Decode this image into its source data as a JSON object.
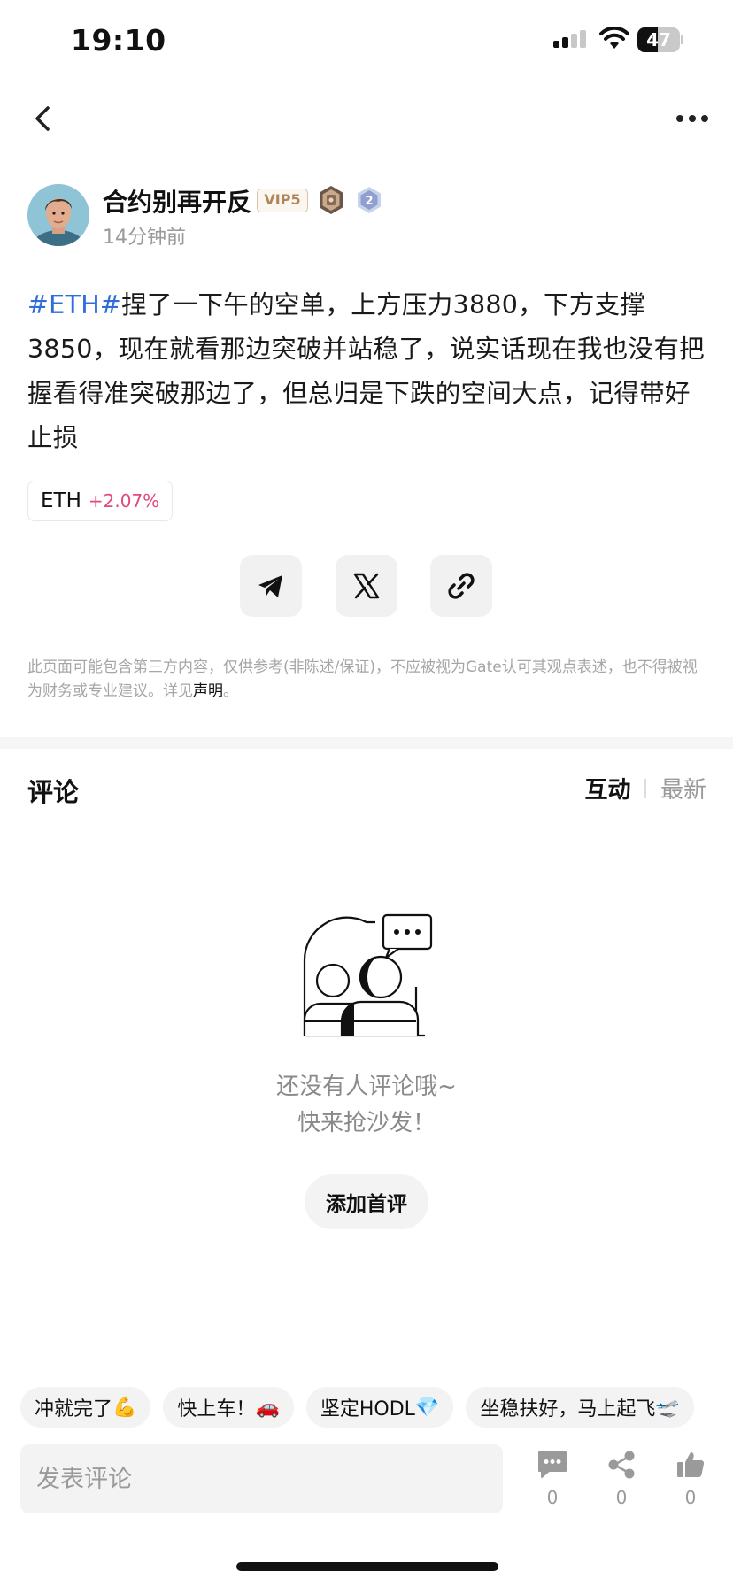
{
  "status_bar": {
    "time": "19:10",
    "battery_level": "47",
    "battery_fraction": 0.47
  },
  "nav": {
    "back_icon": "chevron-left-icon",
    "more_icon": "more-horizontal-icon"
  },
  "author": {
    "name": "合约别再开反",
    "vip_label": "VIP5",
    "level_badge": "2",
    "post_time": "14分钟前"
  },
  "post": {
    "hashtag": "#ETH#",
    "text": "捏了一下午的空单，上方压力3880，下方支撑3850，现在就看那边突破并站稳了，说实话现在我也没有把握看得准突破那边了，但总归是下跌的空间大点，记得带好止损"
  },
  "token": {
    "symbol": "ETH",
    "change": "+2.07%",
    "change_color": "#e4487a"
  },
  "share": {
    "icons": [
      "telegram-icon",
      "x-icon",
      "link-icon"
    ]
  },
  "disclaimer": {
    "text": "此页面可能包含第三方内容，仅供参考(非陈述/保证)，不应被视为Gate认可其观点表述，也不得被视为财务或专业建议。详见",
    "link": "声明",
    "suffix": "。"
  },
  "comments": {
    "title": "评论",
    "tab_active": "互动",
    "tab_other": "最新",
    "empty_line1": "还没有人评论哦~",
    "empty_line2": "快来抢沙发！",
    "add_first_label": "添加首评"
  },
  "quick_replies": [
    {
      "text": "冲就完了",
      "emoji": "💪"
    },
    {
      "text": "快上车！",
      "emoji": "🚗"
    },
    {
      "text": "坚定HODL",
      "emoji": "💎"
    },
    {
      "text": "坐稳扶好，马上起飞",
      "emoji": "🛫"
    }
  ],
  "bottom_bar": {
    "input_placeholder": "发表评论",
    "comment_count": "0",
    "share_count": "0",
    "like_count": "0"
  },
  "colors": {
    "accent_blue": "#2e6ddb",
    "vip_gold": "#b08658",
    "muted": "#9a9a9a"
  }
}
